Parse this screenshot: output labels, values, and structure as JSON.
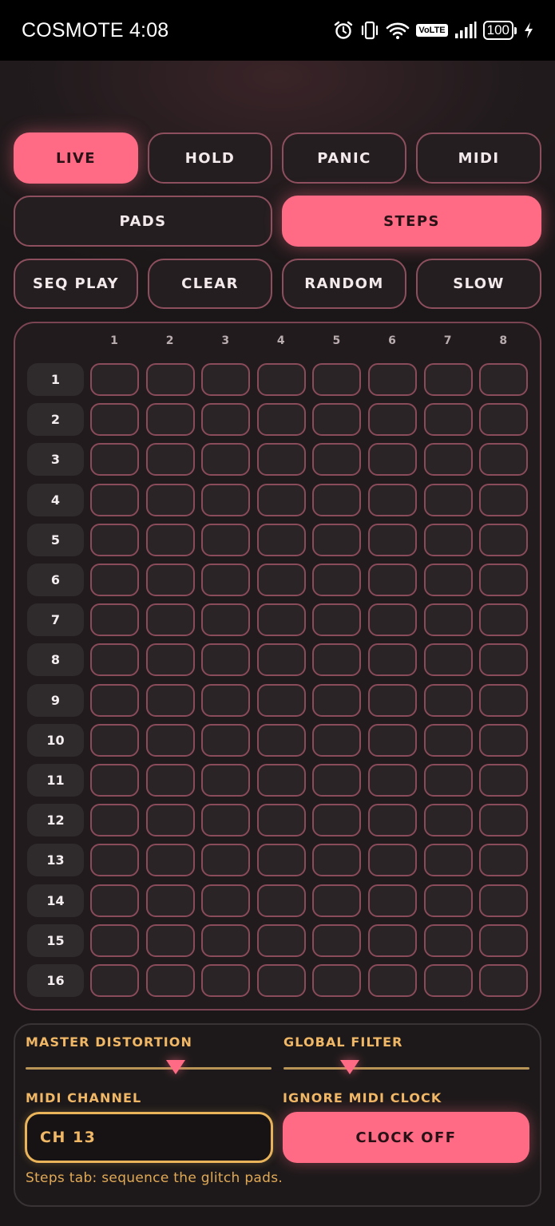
{
  "status_bar": {
    "carrier": "COSMOTE",
    "time": "4:08",
    "network_badge": "VoLTE",
    "battery": "100",
    "icons": [
      "alarm-icon",
      "vibrate-icon",
      "wifi-icon",
      "volte-icon",
      "signal-icon",
      "battery-icon",
      "charging-icon"
    ]
  },
  "toolbar_row1": [
    {
      "label": "LIVE",
      "active": true
    },
    {
      "label": "HOLD",
      "active": false
    },
    {
      "label": "PANIC",
      "active": false
    },
    {
      "label": "MIDI",
      "active": false
    }
  ],
  "tabs": [
    {
      "label": "PADS",
      "active": false
    },
    {
      "label": "STEPS",
      "active": true
    }
  ],
  "seq_controls": [
    {
      "label": "SEQ PLAY"
    },
    {
      "label": "CLEAR"
    },
    {
      "label": "RANDOM"
    },
    {
      "label": "SLOW"
    }
  ],
  "grid": {
    "columns": [
      "1",
      "2",
      "3",
      "4",
      "5",
      "6",
      "7",
      "8"
    ],
    "rows": [
      "1",
      "2",
      "3",
      "4",
      "5",
      "6",
      "7",
      "8",
      "9",
      "10",
      "11",
      "12",
      "13",
      "14",
      "15",
      "16"
    ]
  },
  "controls": {
    "master_distortion": {
      "label": "MASTER DISTORTION",
      "value": 0.61
    },
    "global_filter": {
      "label": "GLOBAL FILTER",
      "value": 0.27
    },
    "midi_channel": {
      "label": "MIDI CHANNEL",
      "value": "CH 13"
    },
    "midi_clock": {
      "label": "IGNORE MIDI CLOCK",
      "button": "CLOCK OFF"
    },
    "hint": "Steps tab: sequence the glitch pads."
  },
  "colors": {
    "accent": "#ff6b85",
    "gold": "#f0b866",
    "cell_border": "#8a4b5a"
  }
}
